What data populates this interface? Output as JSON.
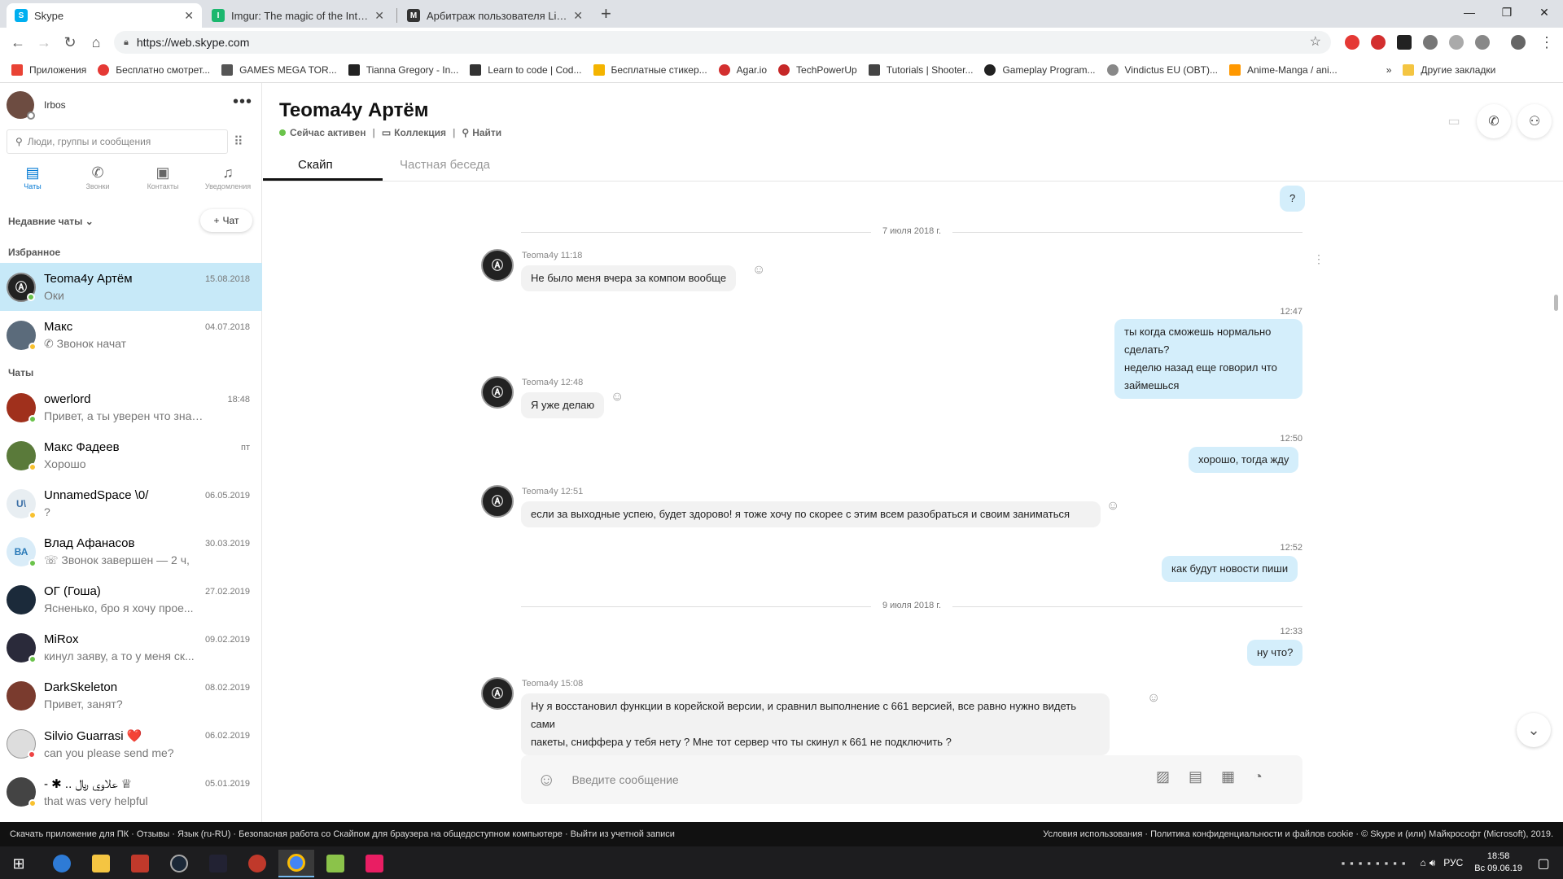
{
  "browser": {
    "tabs": [
      {
        "title": "Skype",
        "active": true,
        "color": "#00aff0",
        "letter": "S"
      },
      {
        "title": "Imgur: The magic of the Internet",
        "active": false,
        "color": "#1bb76e",
        "letter": "I"
      },
      {
        "title": "Арбитраж пользователя LightFi",
        "active": false,
        "color": "#333333",
        "letter": "M"
      }
    ],
    "url": "https://web.skype.com",
    "bookmarks": [
      {
        "label": "Приложения",
        "color": "#e94335"
      },
      {
        "label": "Бесплатно смотрет...",
        "color": "#e53935"
      },
      {
        "label": "GAMES MEGA TOR...",
        "color": "#555555"
      },
      {
        "label": "Tianna Gregory - In...",
        "color": "#222222"
      },
      {
        "label": "Learn to code | Cod...",
        "color": "#333333"
      },
      {
        "label": "Бесплатные стикер...",
        "color": "#f4b400"
      },
      {
        "label": "Agar.io",
        "color": "#d32f2f"
      },
      {
        "label": "TechPowerUp",
        "color": "#c62828"
      },
      {
        "label": "Tutorials | Shooter...",
        "color": "#444444"
      },
      {
        "label": "Gameplay Program...",
        "color": "#222222"
      },
      {
        "label": "Vindictus EU (OBT)...",
        "color": "#888888"
      },
      {
        "label": "Anime-Manga / ani...",
        "color": "#ff9800"
      }
    ],
    "other_bookmarks": "Другие закладки"
  },
  "sidebar": {
    "profile": {
      "name": "Irbos"
    },
    "search_placeholder": "Люди, группы и сообщения",
    "nav": [
      {
        "label": "Чаты",
        "icon": "chat-icon"
      },
      {
        "label": "Звонки",
        "icon": "phone-icon"
      },
      {
        "label": "Контакты",
        "icon": "contacts-icon"
      },
      {
        "label": "Уведомления",
        "icon": "bell-icon"
      }
    ],
    "recent_label": "Недавние чаты",
    "new_chat_label": "Чат",
    "favorites_label": "Избранное",
    "chats_label": "Чаты",
    "favorites": [
      {
        "name": "Teoma4y Артём",
        "preview": "Оки",
        "date": "15.08.2018",
        "color": "#222222"
      },
      {
        "name": "Макс",
        "preview": "Звонок начат",
        "date": "04.07.2018",
        "color": "#5b6b7b"
      }
    ],
    "chats": [
      {
        "name": "owerlord",
        "preview": "Привет, а ты уверен что знаеш...",
        "date": "18:48",
        "color": "#a0301c",
        "initials": ""
      },
      {
        "name": "Макс Фадеев",
        "preview": "Хорошо",
        "date": "пт",
        "color": "#5a7a3a",
        "initials": ""
      },
      {
        "name": "UnnamedSpace \\0/",
        "preview": "?",
        "date": "06.05.2019",
        "color": "#e8eef2",
        "initials": "U\\"
      },
      {
        "name": "Влад Афанасов",
        "preview": "Звонок завершен — 2 ч,",
        "date": "30.03.2019",
        "color": "#d9ecf8",
        "initials": "ВА"
      },
      {
        "name": "ОГ (Гоша)",
        "preview": "Ясненько, бро я хочу прое...",
        "date": "27.02.2019",
        "color": "#1b2a3a",
        "initials": ""
      },
      {
        "name": "MiRox",
        "preview": "кинул заяву, а то у меня ск...",
        "date": "09.02.2019",
        "color": "#2a2a3a",
        "initials": ""
      },
      {
        "name": "DarkSkeleton",
        "preview": "Привет, занят?",
        "date": "08.02.2019",
        "color": "#7a3b2e",
        "initials": ""
      },
      {
        "name": "Silvio Guarrasi ❤️",
        "preview": "can you please send me?",
        "date": "06.02.2019",
        "color": "#dddddd",
        "initials": ""
      },
      {
        "name": "- ✱ .. علاوي ﷼ ♕",
        "preview": "that was very helpful",
        "date": "05.01.2019",
        "color": "#444444",
        "initials": ""
      }
    ]
  },
  "chat": {
    "title": "Teoma4y Артём",
    "status": "Сейчас активен",
    "collection": "Коллекция",
    "find": "Найти",
    "tabs": [
      "Скайп",
      "Частная беседа"
    ],
    "composer_placeholder": "Введите сообщение",
    "date1": "7 июля 2018 г.",
    "date2": "9 июля 2018 г.",
    "messages": {
      "m0": {
        "text": "?"
      },
      "m1": {
        "meta": "Teoma4y 11:18",
        "text": "Не было меня вчера за компом вообще"
      },
      "m2": {
        "time": "12:47",
        "text": "ты когда сможешь нормально сделать?",
        "text2": "неделю назад еще говорил что займешься"
      },
      "m3": {
        "meta": "Teoma4y 12:48",
        "text": "Я уже делаю"
      },
      "m4": {
        "time": "12:50",
        "text": "хорошо, тогда жду"
      },
      "m5": {
        "meta": "Teoma4y 12:51",
        "text": "если за выходные успею, будет здорово! я тоже хочу по скорее с этим всем разобраться и своим заниматься"
      },
      "m6": {
        "time": "12:52",
        "text": "как будут новости пиши"
      },
      "m7": {
        "time": "12:33",
        "text": "ну что?"
      },
      "m8": {
        "meta": "Teoma4y 15:08",
        "text": "Ну я восстановил функции в корейской версии, и сравнил выполнение с 661 версией, все равно нужно видеть сами",
        "text2": "пакеты, сниффера у тебя нету ? Мне тот сервер что ты скинул к 661 не подключить ?"
      }
    }
  },
  "footer": {
    "left": "Скачать приложение для ПК · Отзывы · Язык (ru-RU) · Безопасная работа со Скайпом для браузера на общедоступном компьютере · Выйти из учетной записи",
    "right": "Условия использования · Политика конфиденциальности и файлов cookie · © Skype и (или) Майкрософт (Microsoft), 2019."
  },
  "taskbar": {
    "lang": "РУС",
    "time": "18:58",
    "date": "Вс 09.06.19"
  },
  "colors": {
    "accent": "#0078d4",
    "selected_chat": "#c7e9f8",
    "outgoing_bubble": "#d4eefb",
    "incoming_bubble": "#f2f2f2",
    "online": "#6ac34b",
    "away": "#f8c12f",
    "busy": "#e44"
  }
}
